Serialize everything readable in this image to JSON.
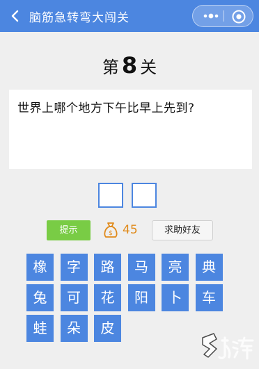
{
  "header": {
    "title": "脑筋急转弯大闯关",
    "background": "#4c86e0"
  },
  "level": {
    "prefix": "第",
    "number": "8",
    "suffix": "关"
  },
  "question": {
    "text": "世界上哪个地方下午比早上先到?"
  },
  "answer_slots": 2,
  "actions": {
    "hint_label": "提示",
    "coins": "45",
    "help_label": "求助好友"
  },
  "keyboard": {
    "rows": [
      [
        "橡",
        "字",
        "路",
        "马",
        "亮",
        "典"
      ],
      [
        "兔",
        "可",
        "花",
        "阳",
        "卜",
        "车"
      ],
      [
        "蛙",
        "朵",
        "皮",
        "",
        "",
        ""
      ]
    ]
  },
  "colors": {
    "accent": "#4c86e0",
    "hint_button": "#79cc45",
    "coin": "#e08a1a"
  }
}
